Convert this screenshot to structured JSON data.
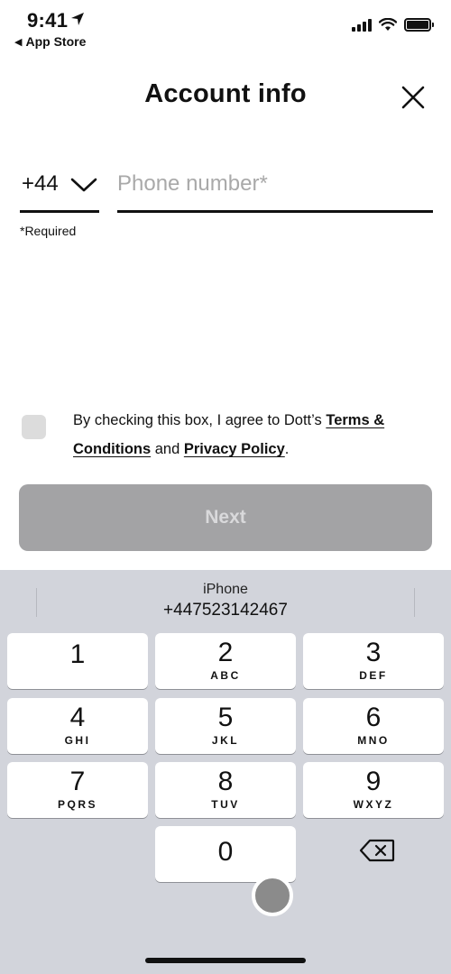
{
  "status_bar": {
    "time": "9:41",
    "back_app": "App Store",
    "icons": [
      "location-arrow-icon",
      "signal-bars-icon",
      "wifi-icon",
      "battery-icon"
    ]
  },
  "header": {
    "title": "Account info",
    "close_icon": "close-icon"
  },
  "phone_form": {
    "country_code": "+44",
    "phone_value": "",
    "phone_placeholder": "Phone number*",
    "required_note": "*Required"
  },
  "terms": {
    "text_before": "By checking this box, I agree to Dott’s ",
    "terms_link": "Terms & Conditions",
    "text_middle": " and ",
    "privacy_link": "Privacy Policy",
    "text_after": ".",
    "checked": false
  },
  "next_button": {
    "label": "Next",
    "enabled": false
  },
  "keyboard": {
    "suggestion_title": "iPhone",
    "suggestion_value": "+447523142467",
    "keys": [
      {
        "num": "1",
        "letters": ""
      },
      {
        "num": "2",
        "letters": "ABC"
      },
      {
        "num": "3",
        "letters": "DEF"
      },
      {
        "num": "4",
        "letters": "GHI"
      },
      {
        "num": "5",
        "letters": "JKL"
      },
      {
        "num": "6",
        "letters": "MNO"
      },
      {
        "num": "7",
        "letters": "PQRS"
      },
      {
        "num": "8",
        "letters": "TUV"
      },
      {
        "num": "9",
        "letters": "WXYZ"
      },
      {
        "num": "0",
        "letters": ""
      }
    ],
    "delete_icon": "backspace-icon"
  },
  "colors": {
    "next_disabled_bg": "#a3a3a5",
    "next_disabled_text": "#d9d9db",
    "keyboard_bg": "#d2d4db",
    "checkbox_bg": "#dcdcdc",
    "placeholder": "#a9a9a9"
  }
}
